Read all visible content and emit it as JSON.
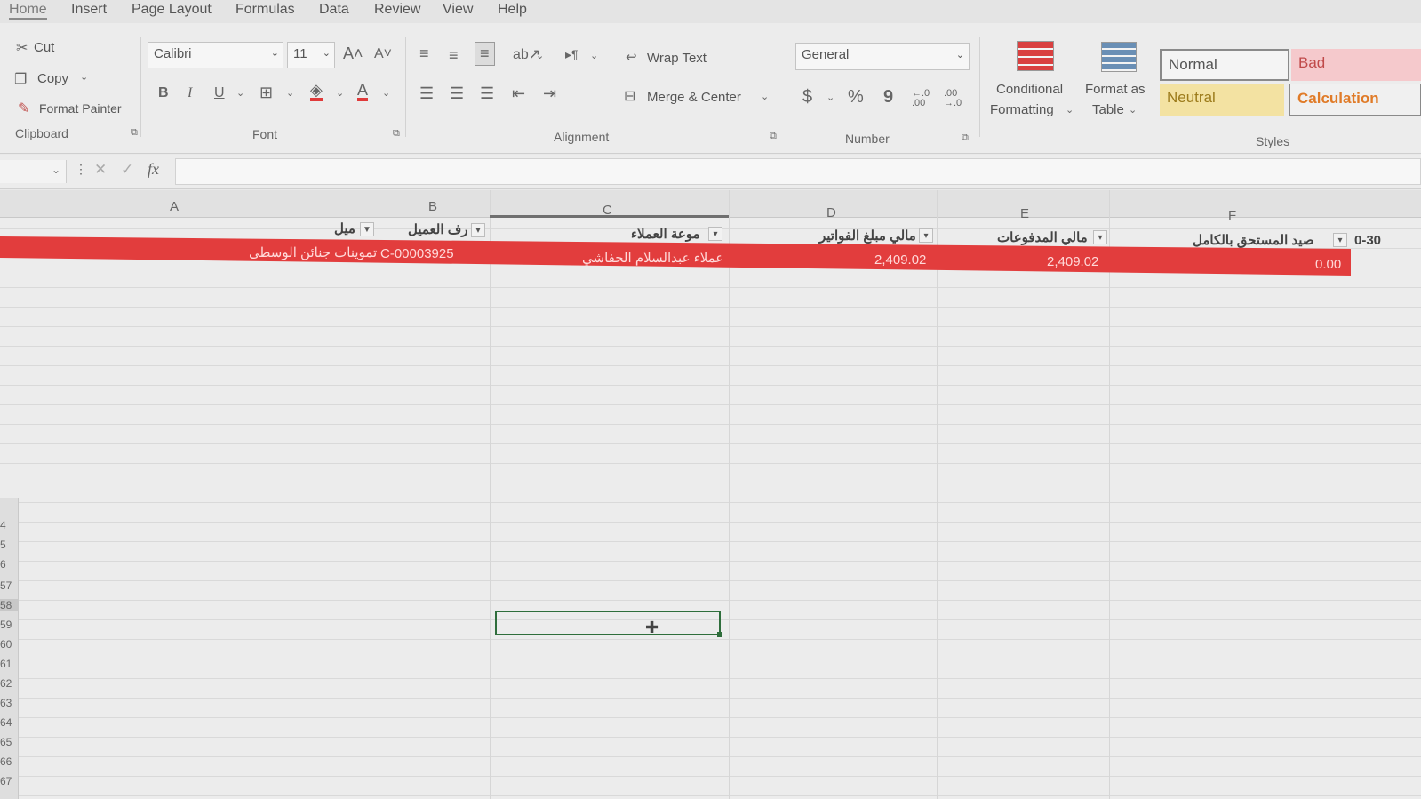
{
  "menu": [
    "Home",
    "Insert",
    "Page Layout",
    "Formulas",
    "Data",
    "Review",
    "View",
    "Help"
  ],
  "clipboard": {
    "cut": "Cut",
    "copy": "Copy",
    "format_painter": "Format Painter",
    "group": "Clipboard"
  },
  "font": {
    "name": "Calibri",
    "size": "11",
    "group": "Font",
    "bold": "B",
    "italic": "I",
    "underline": "U"
  },
  "alignment": {
    "wrap_text": "Wrap Text",
    "merge_center": "Merge & Center",
    "group": "Alignment"
  },
  "number": {
    "format": "General",
    "currency": "$",
    "percent": "%",
    "comma": "9",
    "inc_decimal": "←.0 .00",
    "dec_decimal": ".00 →.0",
    "group": "Number"
  },
  "styles": {
    "conditional": "Conditional",
    "conditional2": "Formatting",
    "format_as": "Format as",
    "format_as2": "Table",
    "normal": "Normal",
    "bad": "Bad",
    "neutral": "Neutral",
    "calculation": "Calculation",
    "group": "Styles"
  },
  "formula": {
    "fx": "fx",
    "cancel": "✕",
    "enter": "✓"
  },
  "columns": [
    "A",
    "B",
    "C",
    "D",
    "E",
    "F"
  ],
  "headers": {
    "a": "ميل",
    "b": "رف العميل",
    "c": "موعة العملاء",
    "d": "مالي مبلغ الفواتير",
    "e": "مالي المدفوعات",
    "f": "صيد المستحق بالكامل",
    "g": "0-30"
  },
  "row": {
    "a": "تموينات جنائن الوسطى",
    "b": "C-00003925",
    "c": "عملاء عبدالسلام الحفاشي",
    "d": "2,409.02",
    "e": "2,409.02",
    "f": "0.00"
  },
  "row_numbers": [
    "4",
    "5",
    "6",
    "57",
    "58",
    "59",
    "60",
    "61",
    "62",
    "63",
    "64",
    "65",
    "66",
    "67"
  ]
}
